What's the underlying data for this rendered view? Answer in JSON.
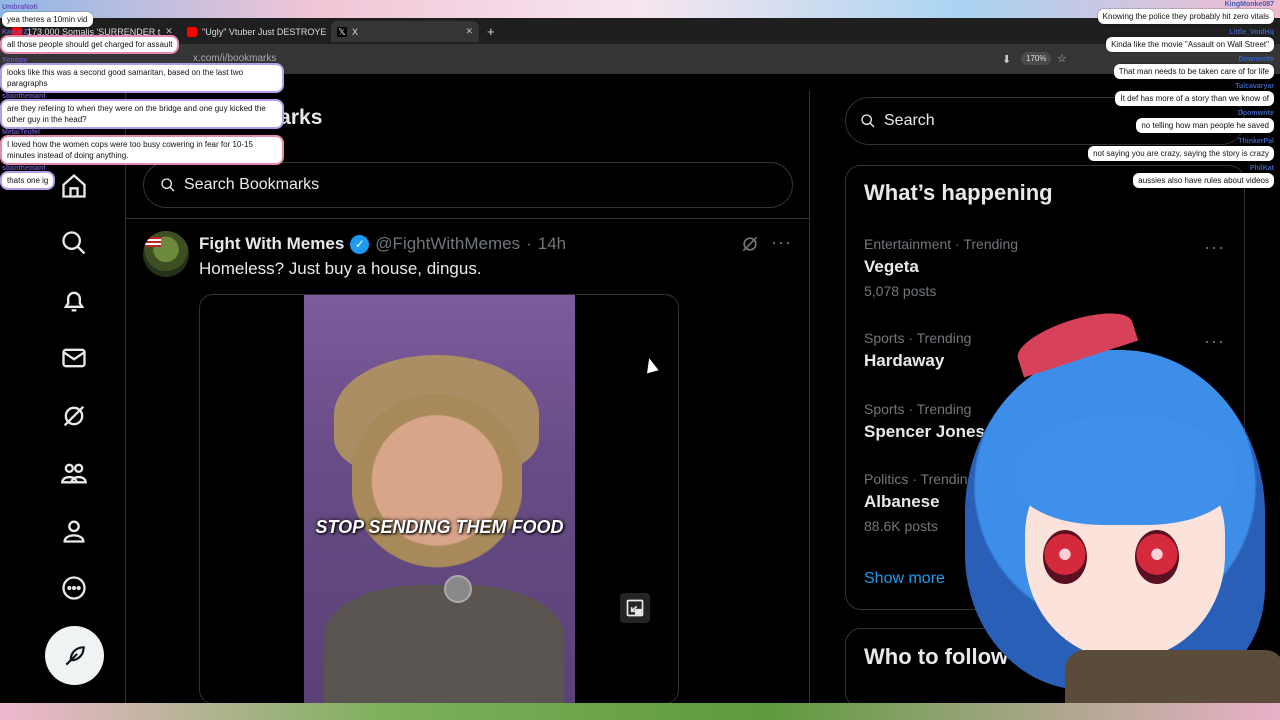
{
  "browser": {
    "tabs": [
      {
        "label": "173,000 Somalis 'SURRENDER t",
        "favicon_color": "#ff0000"
      },
      {
        "label": "\"Ugly\" Vtuber Just DESTROYED",
        "favicon_color": "#ff0000"
      },
      {
        "label": "X",
        "favicon_color": "#ffffff"
      }
    ],
    "url": "x.com/i/bookmarks",
    "zoom": "170%"
  },
  "page": {
    "title": "Bookmarks",
    "search_placeholder": "Search Bookmarks"
  },
  "post": {
    "author_name": "Fight With Memes",
    "handle": "@FightWithMemes",
    "time": "14h",
    "separator": "·",
    "text": "Homeless? Just buy a house, dingus.",
    "video_caption": "STOP SENDING THEM FOOD"
  },
  "sidebar": {
    "search_placeholder": "Search",
    "happening_title": "What’s happening",
    "trends": [
      {
        "category": "Entertainment · Trending",
        "name": "Vegeta",
        "count": "5,078 posts"
      },
      {
        "category": "Sports · Trending",
        "name": "Hardaway",
        "count": ""
      },
      {
        "category": "Sports · Trending",
        "name": "Spencer Jones",
        "count": ""
      },
      {
        "category": "Politics · Trending",
        "name": "Albanese",
        "count": "88.6K posts"
      }
    ],
    "show_more": "Show more",
    "who_to_follow": "Who to follow"
  },
  "chat_left": [
    {
      "user": "UmbraNoti",
      "message": "yea theres a 10min vid"
    },
    {
      "user": "KaiserZ",
      "message": "all those people should get charged for assault"
    },
    {
      "user": "Xenopy",
      "message": "looks like this was a second good samaritan, based on the last two paragraphs"
    },
    {
      "user": "sbanthemant",
      "message": "are they refering to when they were on the bridge and one guy kicked the other guy in the head?"
    },
    {
      "user": "MetalTeufel",
      "message": "I loved how the women cops were too busy cowering in fear for 10-15 minutes instead of doing anything."
    },
    {
      "user": "sbanthemant",
      "message": "thats one ig"
    }
  ],
  "chat_right": [
    {
      "user": "KingMonke087",
      "message": "Knowing the police they probably hit zero vitals"
    },
    {
      "user": "Little_VoidHq",
      "message": "Kinda like the movie \"Assault on Wall Street\""
    },
    {
      "user": "Downwrite",
      "message": "That man needs to be taken care of for life"
    },
    {
      "user": "Tulcavaryar",
      "message": "It def has more of a story than we know of"
    },
    {
      "user": "Doomwrite",
      "message": "no telling how man people he saved"
    },
    {
      "user": "ThinkerPal",
      "message": "not saying you are crazy, saying the story is crazy"
    },
    {
      "user": "PhilKat",
      "message": "aussies also have rules about videos"
    }
  ],
  "colors": {
    "accent": "#1d9bf0",
    "background": "#000000",
    "text_primary": "#e7e9ea",
    "text_secondary": "#71767b",
    "border": "#2f3336"
  }
}
